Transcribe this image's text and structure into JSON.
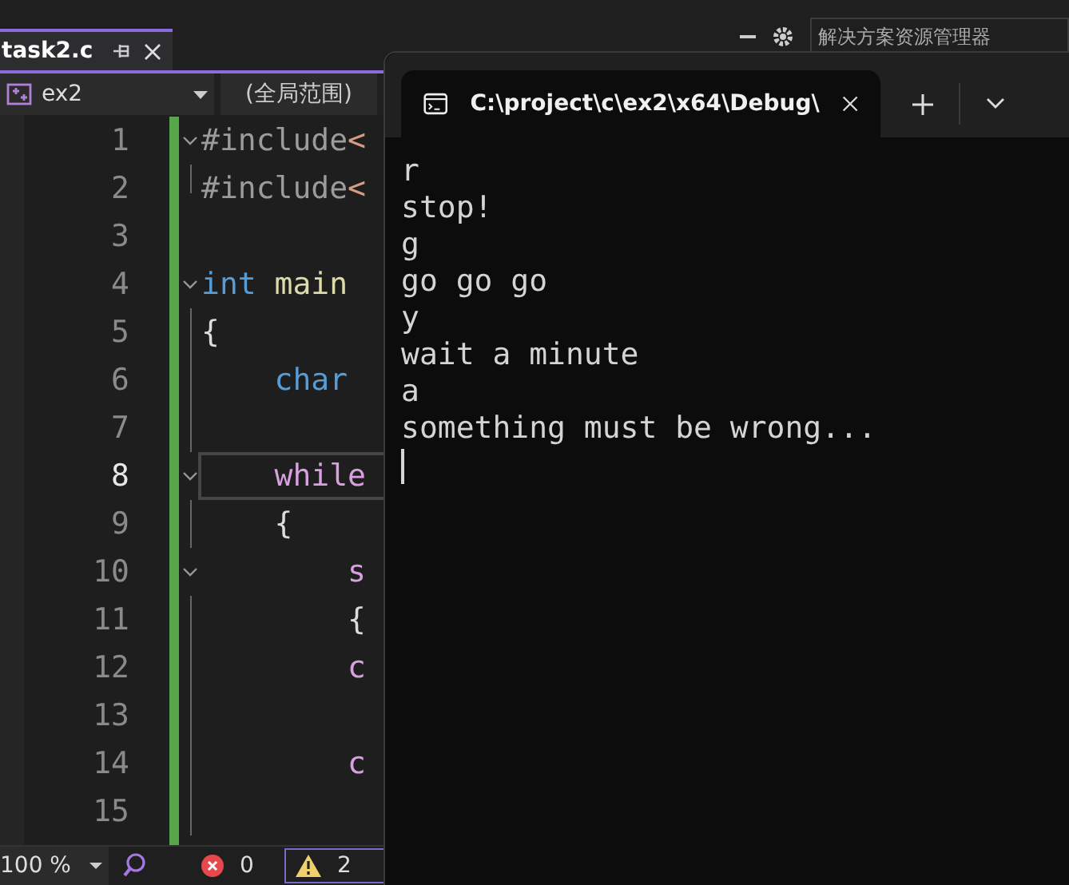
{
  "editor_tab": {
    "title": "task2.c",
    "selected": true
  },
  "solution_search": {
    "placeholder": "解决方案资源管理器"
  },
  "nav_bar": {
    "project": "ex2",
    "scope": "(全局范围)"
  },
  "editor": {
    "lines": [
      {
        "number": "1",
        "kind": "fold",
        "current": false,
        "tokens": [
          {
            "text": "#include",
            "kind": "preproc"
          },
          {
            "text": "<",
            "kind": "string"
          }
        ]
      },
      {
        "number": "2",
        "kind": "end",
        "current": false,
        "tokens": [
          {
            "text": "#include",
            "kind": "preproc"
          },
          {
            "text": "<",
            "kind": "string"
          }
        ]
      },
      {
        "number": "3",
        "kind": "blank",
        "current": false
      },
      {
        "number": "4",
        "kind": "fold",
        "current": false,
        "tokens": [
          {
            "text": "int",
            "kind": "keyword"
          },
          {
            "text": " main",
            "kind": "function"
          }
        ]
      },
      {
        "number": "5",
        "kind": "body",
        "current": false,
        "tokens": [
          {
            "text": "{",
            "kind": "plain"
          }
        ]
      },
      {
        "number": "6",
        "kind": "body",
        "current": false,
        "tokens": [
          {
            "text": "    char",
            "kind": "keyword"
          }
        ]
      },
      {
        "number": "7",
        "kind": "body",
        "current": false
      },
      {
        "number": "8",
        "kind": "fold",
        "current": true,
        "tokens": [
          {
            "text": "    while",
            "kind": "control"
          }
        ]
      },
      {
        "number": "9",
        "kind": "body",
        "current": false,
        "tokens": [
          {
            "text": "    {",
            "kind": "plain"
          }
        ]
      },
      {
        "number": "10",
        "kind": "fold",
        "current": false,
        "tokens": [
          {
            "text": "        s",
            "kind": "control"
          }
        ]
      },
      {
        "number": "11",
        "kind": "body",
        "current": false,
        "tokens": [
          {
            "text": "        {",
            "kind": "plain"
          }
        ]
      },
      {
        "number": "12",
        "kind": "body",
        "current": false,
        "tokens": [
          {
            "text": "        c",
            "kind": "control"
          }
        ]
      },
      {
        "number": "13",
        "kind": "body",
        "current": false
      },
      {
        "number": "14",
        "kind": "body",
        "current": false,
        "tokens": [
          {
            "text": "        c",
            "kind": "control"
          }
        ]
      },
      {
        "number": "15",
        "kind": "body",
        "current": false
      }
    ]
  },
  "status_bar": {
    "zoom": "100 %",
    "errors": "0",
    "warnings": "2"
  },
  "terminal": {
    "tab_title": "C:\\project\\c\\ex2\\x64\\Debug\\",
    "output": [
      "r",
      "stop!",
      "g",
      "go go go",
      "y",
      "wait a minute",
      "a",
      "something must be wrong..."
    ],
    "cursor": true
  }
}
